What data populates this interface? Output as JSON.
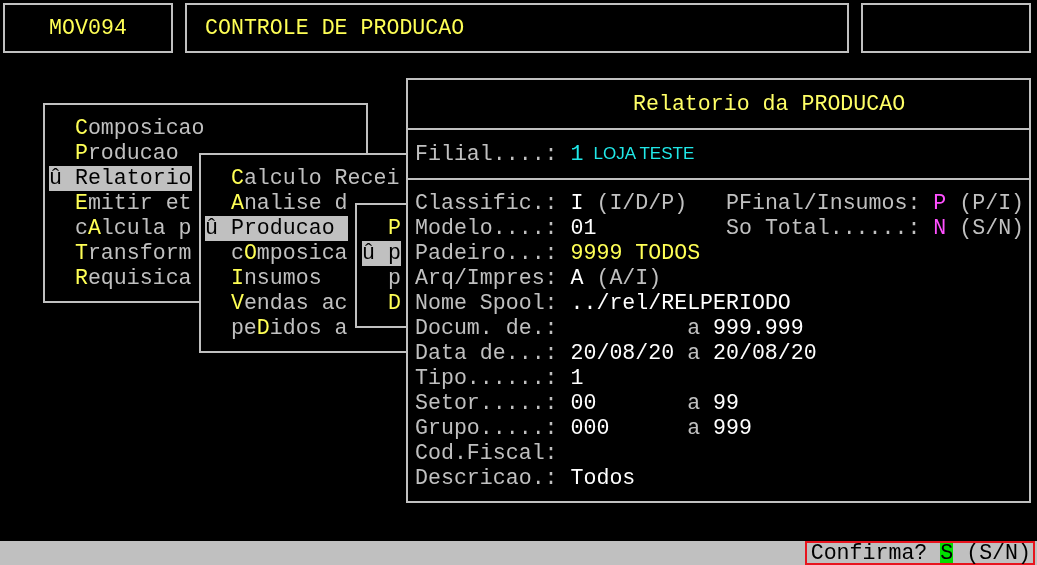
{
  "header": {
    "program_code": "MOV094",
    "title": "CONTROLE DE PRODUCAO"
  },
  "menus": [
    {
      "items": [
        {
          "selected": false,
          "parts": [
            {
              "text": "C",
              "hotkey": true
            },
            {
              "text": "omposicao",
              "hotkey": false
            }
          ]
        },
        {
          "selected": false,
          "parts": [
            {
              "text": "P",
              "hotkey": true
            },
            {
              "text": "roducao",
              "hotkey": false
            }
          ]
        },
        {
          "selected": true,
          "marker": "û",
          "parts": [
            {
              "text": "Relatorio"
            }
          ]
        },
        {
          "selected": false,
          "parts": [
            {
              "text": "E",
              "hotkey": true
            },
            {
              "text": "mitir et",
              "hotkey": false
            }
          ]
        },
        {
          "selected": false,
          "parts": [
            {
              "text": "c",
              "hotkey": false
            },
            {
              "text": "A",
              "hotkey": true
            },
            {
              "text": "lcula p",
              "hotkey": false
            }
          ]
        },
        {
          "selected": false,
          "parts": [
            {
              "text": "T",
              "hotkey": true
            },
            {
              "text": "ransform",
              "hotkey": false
            }
          ]
        },
        {
          "selected": false,
          "parts": [
            {
              "text": "R",
              "hotkey": true
            },
            {
              "text": "equisica",
              "hotkey": false
            }
          ]
        }
      ]
    },
    {
      "items": [
        {
          "selected": false,
          "parts": [
            {
              "text": "C",
              "hotkey": true
            },
            {
              "text": "alculo Recei",
              "hotkey": false
            }
          ]
        },
        {
          "selected": false,
          "parts": [
            {
              "text": "A",
              "hotkey": true
            },
            {
              "text": "nalise d",
              "hotkey": false
            }
          ]
        },
        {
          "selected": true,
          "marker": "û",
          "parts": [
            {
              "text": "Producao"
            }
          ]
        },
        {
          "selected": false,
          "parts": [
            {
              "text": "c",
              "hotkey": false
            },
            {
              "text": "O",
              "hotkey": true
            },
            {
              "text": "mposica",
              "hotkey": false
            }
          ]
        },
        {
          "selected": false,
          "parts": [
            {
              "text": "I",
              "hotkey": true
            },
            {
              "text": "nsumos",
              "hotkey": false
            }
          ]
        },
        {
          "selected": false,
          "parts": [
            {
              "text": "V",
              "hotkey": true
            },
            {
              "text": "endas ac",
              "hotkey": false
            }
          ]
        },
        {
          "selected": false,
          "parts": [
            {
              "text": "pe",
              "hotkey": false
            },
            {
              "text": "D",
              "hotkey": true
            },
            {
              "text": "idos a",
              "hotkey": false
            }
          ]
        }
      ]
    },
    {
      "items": [
        {
          "selected": false,
          "parts": [
            {
              "text": "P",
              "hotkey": true
            }
          ]
        },
        {
          "selected": true,
          "marker": "û",
          "parts": [
            {
              "text": "p"
            }
          ]
        },
        {
          "selected": false,
          "parts": [
            {
              "text": "p",
              "hotkey": false
            }
          ]
        },
        {
          "selected": false,
          "parts": [
            {
              "text": "D",
              "hotkey": true
            }
          ]
        }
      ]
    }
  ],
  "report": {
    "title": "Relatorio da PRODUCAO",
    "branch": {
      "label": "Filial....:",
      "code": "1",
      "name": "LOJA TESTE"
    },
    "fields": [
      {
        "label": "Classific.:",
        "value": "I",
        "kind": "plain",
        "hint": "(I/D/P)",
        "right": {
          "label": "PFinal/Insumos:",
          "value": "P",
          "kind": "option",
          "hint": "(P/I)"
        }
      },
      {
        "label": "Modelo....:",
        "value": "01",
        "kind": "plain",
        "right": {
          "label": "So Total......:",
          "value": "N",
          "kind": "option",
          "hint": "(S/N)"
        }
      },
      {
        "label": "Padeiro...:",
        "value": "9999 TODOS",
        "kind": "lookup"
      },
      {
        "label": "Arq/Impres:",
        "value": "A",
        "kind": "plain",
        "hint": "(A/I)"
      },
      {
        "label": "Nome Spool:",
        "value": "../rel/RELPERIODO",
        "kind": "plain"
      },
      {
        "label": "Docum. de.:",
        "range_word": "a",
        "to": "999.999"
      },
      {
        "label": "Data de...:",
        "value": "20/08/20",
        "kind": "plain",
        "range_word": "a",
        "to": "20/08/20"
      },
      {
        "label": "Tipo......:",
        "value": "1",
        "kind": "plain"
      },
      {
        "label": "Setor.....:",
        "value": "00",
        "kind": "plain",
        "range_word": "a",
        "to": "99"
      },
      {
        "label": "Grupo.....:",
        "value": "000",
        "kind": "plain",
        "range_word": "a",
        "to": "999"
      },
      {
        "label": "Cod.Fiscal:"
      },
      {
        "label": "Descricao.:",
        "value": "Todos",
        "kind": "plain"
      }
    ]
  },
  "status_bar": {
    "prompt": "Confirma?",
    "answer": "S",
    "hint": "(S/N)"
  }
}
